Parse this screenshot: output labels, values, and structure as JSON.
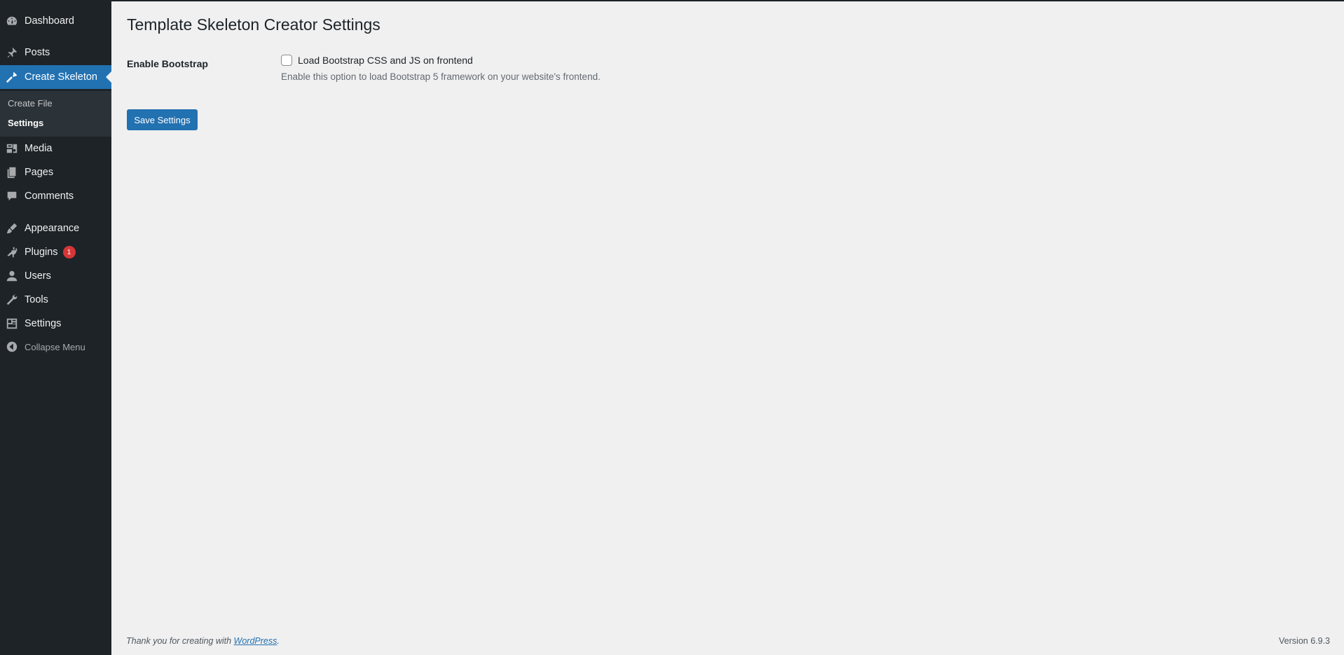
{
  "sidebar": {
    "items": [
      {
        "label": "Dashboard",
        "icon": "dashboard-icon"
      },
      {
        "label": "Posts",
        "icon": "pin-icon"
      },
      {
        "label": "Create Skeleton",
        "icon": "hammer-icon"
      },
      {
        "label": "Media",
        "icon": "media-icon"
      },
      {
        "label": "Pages",
        "icon": "pages-icon"
      },
      {
        "label": "Comments",
        "icon": "comment-icon"
      },
      {
        "label": "Appearance",
        "icon": "paintbrush-icon"
      },
      {
        "label": "Plugins",
        "icon": "plug-icon",
        "badge": "1"
      },
      {
        "label": "Users",
        "icon": "user-icon"
      },
      {
        "label": "Tools",
        "icon": "wrench-icon"
      },
      {
        "label": "Settings",
        "icon": "settings-icon"
      }
    ],
    "submenu": [
      "Create File",
      "Settings"
    ],
    "collapse_label": "Collapse Menu"
  },
  "main": {
    "title": "Template Skeleton Creator Settings",
    "field_label": "Enable Bootstrap",
    "checkbox_label": "Load Bootstrap CSS and JS on frontend",
    "checkbox_checked": false,
    "description": "Enable this option to load Bootstrap 5 framework on your website's frontend.",
    "save_label": "Save Settings"
  },
  "footer": {
    "thanks_prefix": "Thank you for creating with ",
    "link_text": "WordPress",
    "thanks_suffix": ".",
    "version": "Version 6.9.3"
  },
  "colors": {
    "sidebar_bg": "#1d2327",
    "accent": "#2271b1",
    "badge": "#d63638",
    "page_bg": "#f0f0f1"
  }
}
